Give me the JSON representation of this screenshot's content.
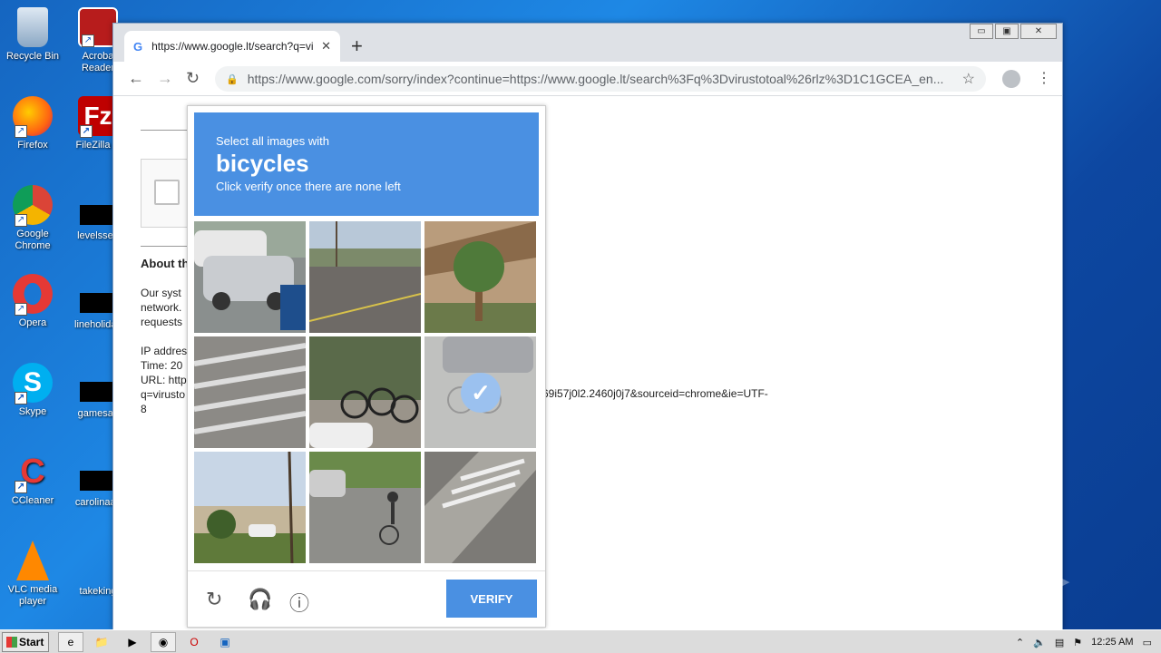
{
  "desktop": {
    "icons": [
      {
        "label": "Recycle Bin",
        "icon": "recycle-bin-icon"
      },
      {
        "label": "Firefox",
        "icon": "firefox-icon"
      },
      {
        "label": "Google Chrome",
        "icon": "chrome-icon"
      },
      {
        "label": "Opera",
        "icon": "opera-icon"
      },
      {
        "label": "Skype",
        "icon": "skype-icon"
      },
      {
        "label": "CCleaner",
        "icon": "ccleaner-icon"
      },
      {
        "label": "VLC media player",
        "icon": "vlc-icon"
      },
      {
        "label": "Acroba Reader",
        "icon": "acrobat-icon"
      },
      {
        "label": "FileZilla C",
        "icon": "filezilla-icon"
      },
      {
        "label": "levelssep",
        "icon": "file-icon"
      },
      {
        "label": "lineholiday",
        "icon": "file-icon"
      },
      {
        "label": "gamesav",
        "icon": "file-icon"
      },
      {
        "label": "carolinaas",
        "icon": "file-icon"
      },
      {
        "label": "takeking",
        "icon": "file-icon"
      }
    ]
  },
  "browser": {
    "tab_title": "https://www.google.lt/search?q=vir",
    "tab_close": "✕",
    "new_tab": "+",
    "url": "https://www.google.com/sorry/index?continue=https://www.google.lt/search%3Fq%3Dvirustotoal%26rlz%3D1C1GCEA_en...",
    "window_controls": {
      "minimize": "▭",
      "restore": "▣",
      "close": "✕"
    }
  },
  "page": {
    "about_heading": "About th",
    "para1": "Our syst\nnetwork.\nrequests",
    "para2": "IP addres\nTime: 20\nURL: http\nq=virusto\n8",
    "url_tail": "69i57j0l2.2460j0j7&sourceid=chrome&ie=UTF-"
  },
  "captcha": {
    "line1": "Select all images with",
    "target": "bicycles",
    "line3": "Click verify once there are none left",
    "verify_label": "VERIFY",
    "tiles": [
      {
        "scene": "parked-cars",
        "selected": false
      },
      {
        "scene": "street-road",
        "selected": false
      },
      {
        "scene": "palm-tree-house",
        "selected": false
      },
      {
        "scene": "crosswalk",
        "selected": false
      },
      {
        "scene": "bicycle-rack",
        "selected": false
      },
      {
        "scene": "cyclist-street",
        "selected": true
      },
      {
        "scene": "house-pole",
        "selected": false
      },
      {
        "scene": "cyclist-road",
        "selected": false
      },
      {
        "scene": "crosswalk-curb",
        "selected": false
      }
    ]
  },
  "watermark": "ANY ▷ RUN",
  "taskbar": {
    "start_label": "Start",
    "clock": "12:25 AM"
  }
}
